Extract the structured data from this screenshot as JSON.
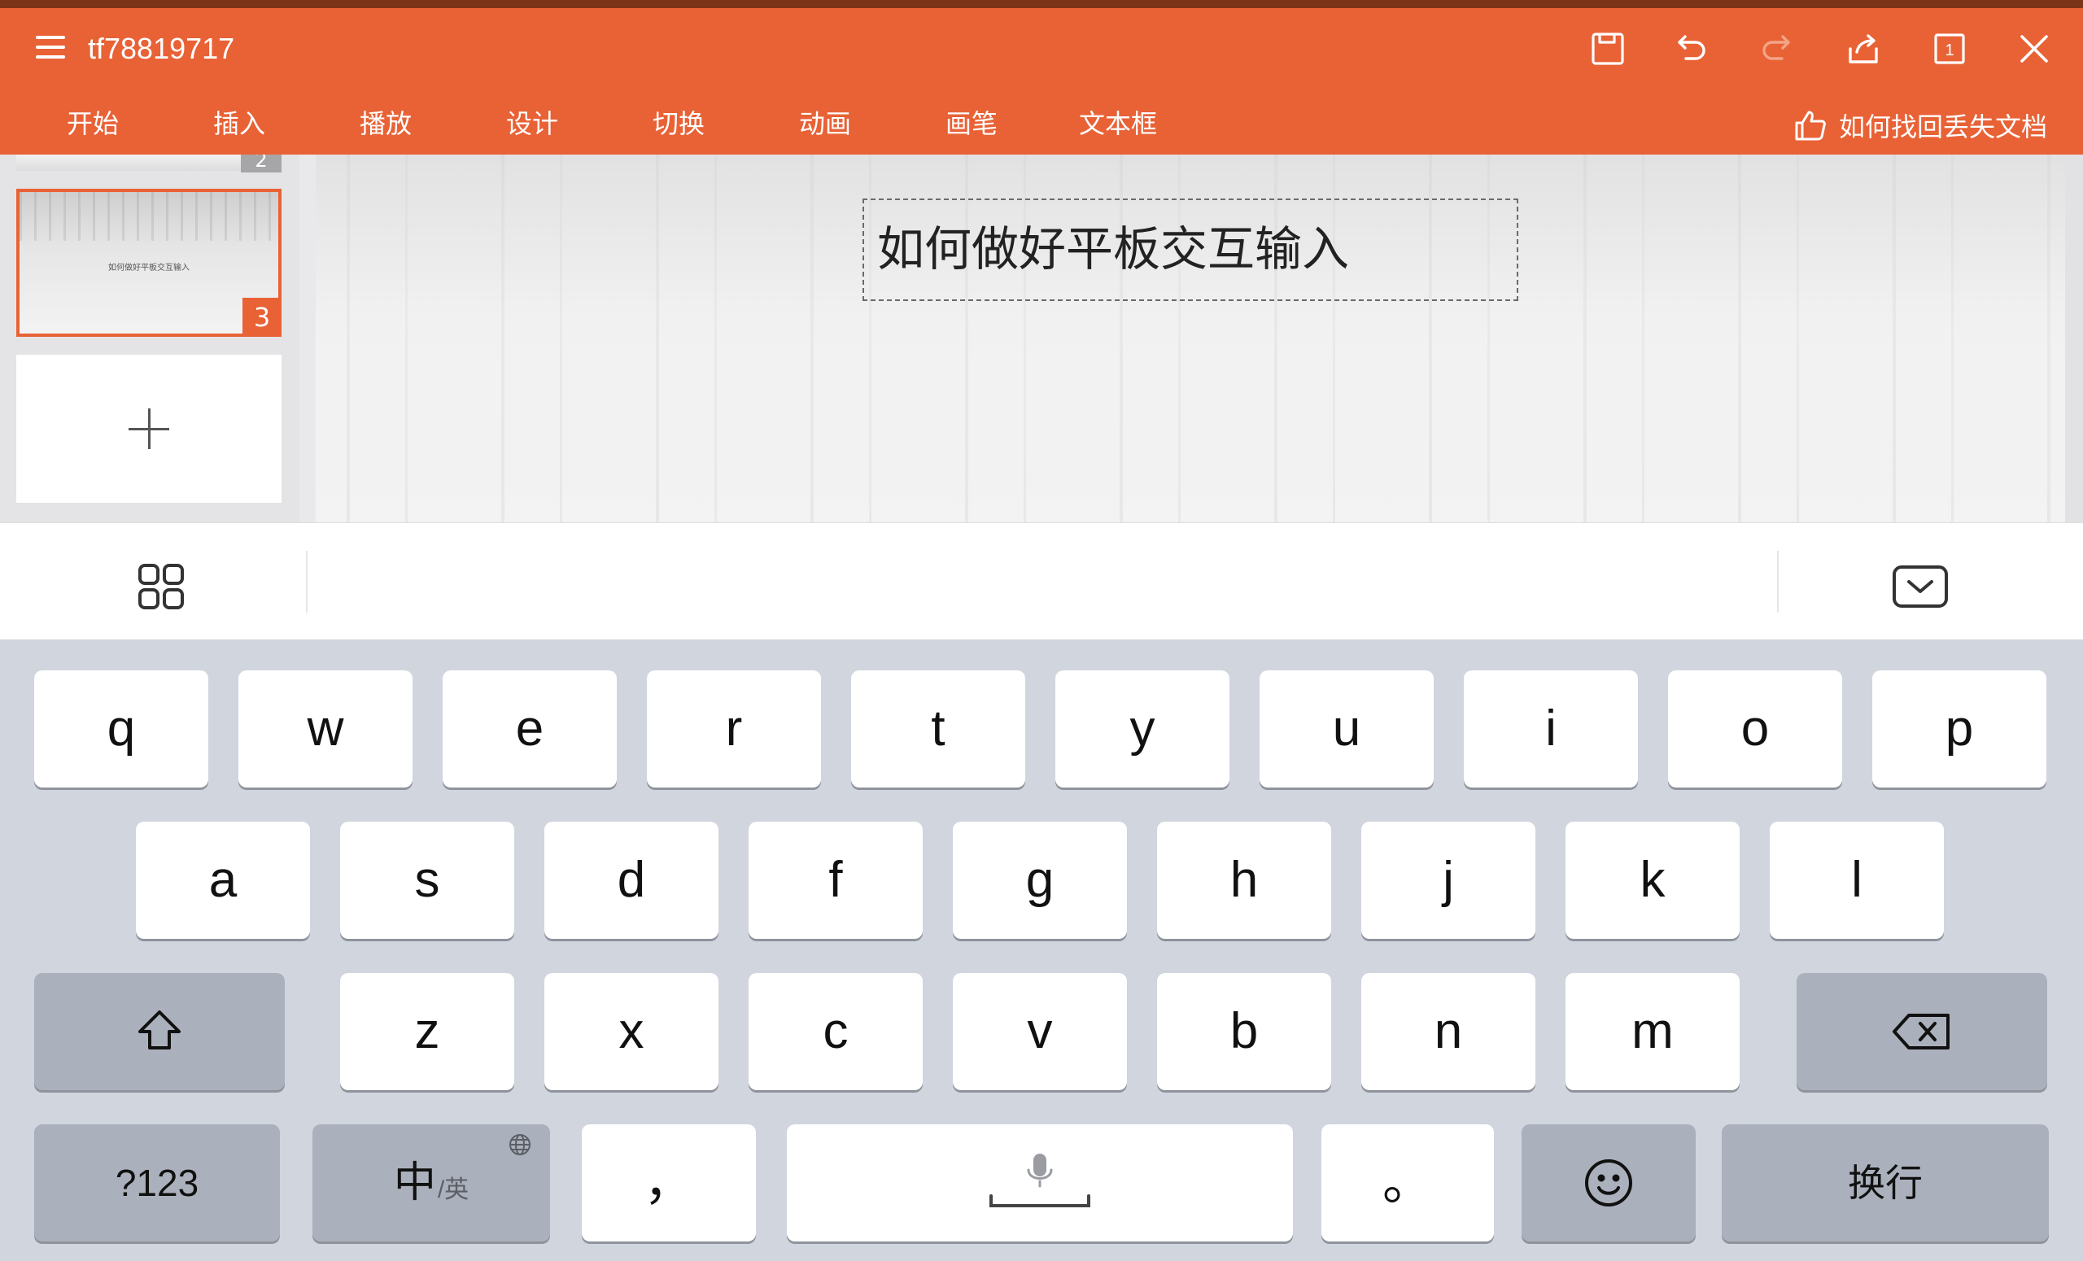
{
  "app": {
    "document_title": "tf78819717",
    "accent_color": "#e86236"
  },
  "toolbar": {
    "icons": [
      "menu-icon",
      "save-icon",
      "undo-icon",
      "redo-icon",
      "share-icon",
      "page-count-icon",
      "close-icon"
    ],
    "page_count": "1",
    "tabs": [
      "开始",
      "插入",
      "播放",
      "设计",
      "切换",
      "动画",
      "画笔",
      "文本框"
    ],
    "help_label": "如何找回丢失文档"
  },
  "slides_panel": {
    "prev_slide_number": "2",
    "current_slide": {
      "number": "3",
      "title": "如何做好平板交互输入"
    },
    "add_icon": "plus-icon"
  },
  "slide": {
    "title_text": "如何做好平板交互输入"
  },
  "keyboard": {
    "toolbar_icons": [
      "apps-grid-icon",
      "hide-keyboard-icon"
    ],
    "row1": [
      "q",
      "w",
      "e",
      "r",
      "t",
      "y",
      "u",
      "i",
      "o",
      "p"
    ],
    "row2": [
      "a",
      "s",
      "d",
      "f",
      "g",
      "h",
      "j",
      "k",
      "l"
    ],
    "row3": [
      "z",
      "x",
      "c",
      "v",
      "b",
      "n",
      "m"
    ],
    "numbers_key": "?123",
    "lang_key_main": "中",
    "lang_key_sub": "/英",
    "comma_key": "，",
    "period_key": "。",
    "enter_key": "换行"
  }
}
